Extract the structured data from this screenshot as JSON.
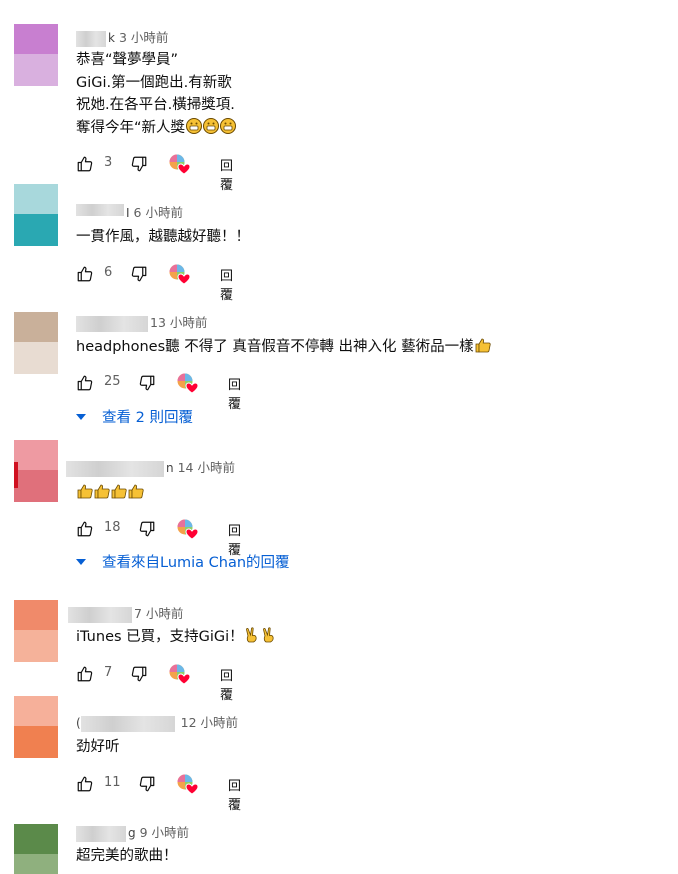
{
  "comments": [
    {
      "name_fragment": "k",
      "time": "3 小時前",
      "lines": [
        "恭喜“聲夢學員”",
        "GiGi.第一個跑出.有新歌",
        "祝她.在各平台.橫掃獎項.",
        "奪得今年“新人獎"
      ],
      "line_emojis": [
        "grin-emoji",
        "grin-emoji",
        "grin-emoji"
      ],
      "likes": "3",
      "reply_label": "回覆",
      "avatar_colors": [
        "#c87fd0",
        "#d9b0df"
      ]
    },
    {
      "name_fragment": "I",
      "time": "6 小時前",
      "lines": [
        "一貫作風，越聽越好聽！！"
      ],
      "likes": "6",
      "reply_label": "回覆",
      "avatar_colors": [
        "#a8d8dc",
        "#2aa8b2"
      ]
    },
    {
      "name_fragment": "",
      "time": "13 小時前",
      "lines": [
        "headphones聽 不得了 真音假音不停轉 出神入化 藝術品一樣"
      ],
      "line_emojis": [
        "thumbs-up-emoji"
      ],
      "likes": "25",
      "reply_label": "回覆",
      "replies_link": "查看 2 則回覆",
      "avatar_colors": [
        "#c9b09a",
        "#e8dcd2"
      ]
    },
    {
      "name_fragment": "n",
      "time": "14 小時前",
      "lines": [
        ""
      ],
      "line_emojis": [
        "thumbs-up-emoji",
        "thumbs-up-emoji",
        "thumbs-up-emoji",
        "thumbs-up-emoji"
      ],
      "likes": "18",
      "reply_label": "回覆",
      "replies_link": "查看來自Lumia Chan的回覆",
      "avatar_colors": [
        "#ee9aa2",
        "#e0707b"
      ]
    },
    {
      "name_fragment": "",
      "time": "7 小時前",
      "lines": [
        "iTunes 已買，支持GiGi！"
      ],
      "line_emojis": [
        "victory-hand-emoji",
        "victory-hand-emoji"
      ],
      "likes": "7",
      "reply_label": "回覆",
      "avatar_colors": [
        "#f08a6a",
        "#f5b29a"
      ]
    },
    {
      "name_fragment": "(",
      "time": "12 小時前",
      "lines": [
        "劲好听"
      ],
      "likes": "11",
      "reply_label": "回覆",
      "avatar_colors": [
        "#f6b09a",
        "#f08050"
      ]
    },
    {
      "name_fragment": "g",
      "time": "9 小時前",
      "lines": [
        "超完美的歌曲！"
      ],
      "avatar_colors": [
        "#5b8a4a",
        "#8fb07e"
      ]
    }
  ],
  "colors": {
    "link_blue": "#065fd4",
    "meta_gray": "#606060",
    "heart_red": "#ff0033"
  },
  "icons": {
    "like": "thumbs-up-icon",
    "dislike": "thumbs-down-icon",
    "creator_heart": "creator-heart-icon"
  }
}
